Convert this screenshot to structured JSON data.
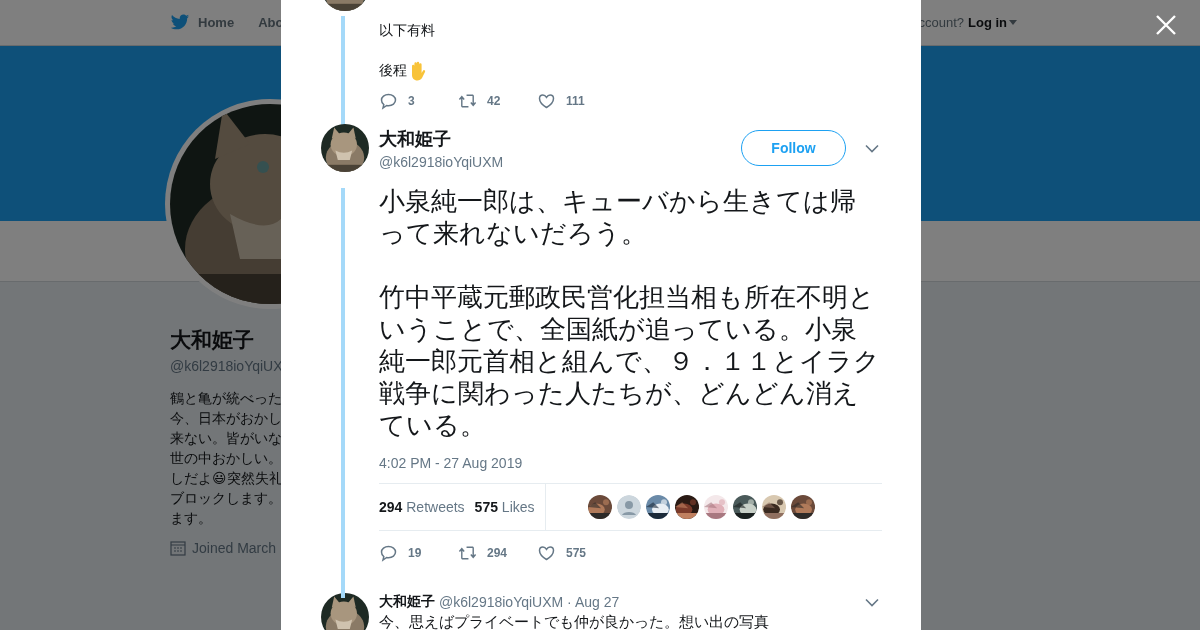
{
  "background_page": {
    "nav": {
      "items": [
        {
          "label": "Home",
          "selected": false
        },
        {
          "label": "Abo",
          "selected": false
        }
      ],
      "account_prompt": "ccount?",
      "login": "Log in"
    },
    "profile": {
      "name": "大和姫子",
      "handle": "@k6l2918ioYqiUX",
      "bio_lines": [
        "鶴と亀が統べった",
        "今、日本がおかし",
        "来ない。皆がいな",
        "世の中おかしい。",
        "しだよ😃突然失礼",
        "ブロックします。",
        "ます。"
      ],
      "joined": "Joined March"
    }
  },
  "modal": {
    "previous_tweet": {
      "lines": [
        "以下有料",
        "後程"
      ],
      "actions": {
        "replies": "3",
        "retweets": "42",
        "likes": "111"
      }
    },
    "tweet": {
      "name": "大和姫子",
      "handle": "@k6l2918ioYqiUXM",
      "follow": "Follow",
      "paragraphs": [
        "小泉純一郎は、キューバから生きては帰って来れないだろう。",
        "竹中平蔵元郵政民営化担当相も所在不明ということで、全国紙が追っている。小泉純一郎元首相と組んで、９．１１とイラク戦争に関わった人たちが、どんどん消えている。"
      ],
      "timestamp": "4:02 PM - 27 Aug 2019",
      "retweet_count": "294",
      "retweet_label": "Retweets",
      "like_count": "575",
      "like_label": "Likes",
      "likers": [
        {
          "kind": "picture"
        },
        {
          "kind": "default"
        },
        {
          "kind": "picture"
        },
        {
          "kind": "picture"
        },
        {
          "kind": "picture"
        },
        {
          "kind": "picture"
        },
        {
          "kind": "picture"
        },
        {
          "kind": "picture"
        }
      ],
      "actions": {
        "replies": "19",
        "retweets": "294",
        "likes": "575"
      }
    },
    "reply": {
      "name": "大和姫子",
      "handle": "@k6l2918ioYqiUXM",
      "date": "· Aug 27",
      "text": "今、思えばプライベートでも仲が良かった。想い出の写真"
    }
  }
}
